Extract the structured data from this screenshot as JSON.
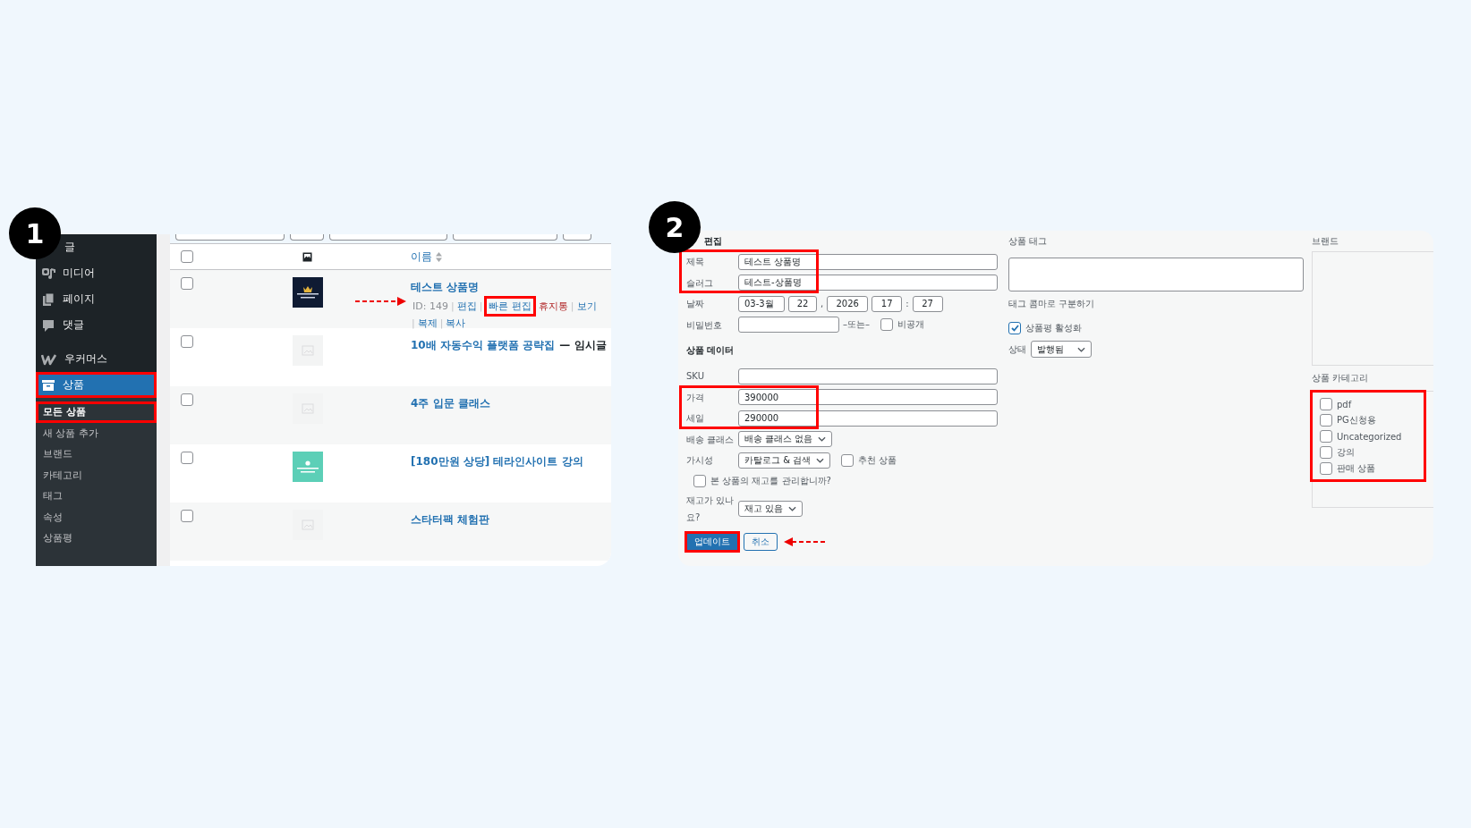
{
  "product_list": {
    "badge": "1",
    "sidebar": {
      "items": [
        {
          "label": "글",
          "selected": false,
          "highlighted": false
        },
        {
          "label": "미디어",
          "selected": false,
          "highlighted": false
        },
        {
          "label": "페이지",
          "selected": false,
          "highlighted": false
        },
        {
          "label": "댓글",
          "selected": false,
          "highlighted": false
        },
        {
          "label": "우커머스",
          "selected": false,
          "highlighted": false
        },
        {
          "label": "상품",
          "selected": true,
          "highlighted": true
        }
      ],
      "submenu": [
        {
          "label": "모든 상품",
          "selected": true,
          "highlighted": true
        },
        {
          "label": "새 상품 추가",
          "selected": false,
          "highlighted": false
        },
        {
          "label": "브랜드",
          "selected": false,
          "highlighted": false
        },
        {
          "label": "카테고리",
          "selected": false,
          "highlighted": false
        },
        {
          "label": "태그",
          "selected": false,
          "highlighted": false
        },
        {
          "label": "속성",
          "selected": false,
          "highlighted": false
        },
        {
          "label": "상품평",
          "selected": false,
          "highlighted": false
        }
      ]
    },
    "table": {
      "select_all_checked": false,
      "columns": [
        {
          "label": "이름",
          "sortable": true
        }
      ],
      "rows": [
        {
          "title": "테스트 상품명",
          "checked": false,
          "actions": [
            {
              "label": "ID: 149",
              "kind": "id",
              "separator": "|",
              "highlighted": false
            },
            {
              "label": "편집",
              "kind": "link",
              "separator": "|",
              "highlighted": false
            },
            {
              "label": "빠른 편집",
              "kind": "link",
              "highlighted": true
            },
            {
              "label": "휴지통",
              "kind": "delete",
              "separator": "|",
              "highlighted": false
            },
            {
              "label": "보기",
              "kind": "link",
              "separator": "|",
              "highlighted": false
            },
            {
              "label": "복제",
              "kind": "link",
              "separator": "|",
              "highlighted": false
            },
            {
              "label": "복사",
              "kind": "link",
              "highlighted": false
            }
          ]
        },
        {
          "title": "10배 자동수익 플랫폼 공략집",
          "status": "— 임시글",
          "checked": false
        },
        {
          "title": "4주 입문 클래스",
          "checked": false
        },
        {
          "title": "[180만원 상당] 테라인사이트 강의",
          "checked": false
        },
        {
          "title": "스타터팩 체험판",
          "checked": false
        }
      ]
    }
  },
  "quick_edit": {
    "badge": "2",
    "heading": "편집",
    "fields": [
      {
        "kind": "text",
        "label": "제목",
        "value": "테스트 상품명",
        "highlighted": true
      },
      {
        "kind": "text",
        "label": "슬러그",
        "value": "테스트-상품명",
        "highlighted": true
      },
      {
        "kind": "date",
        "label": "날짜",
        "month": "03-3월",
        "day": "22",
        "date_separator": ",",
        "year": "2026",
        "hour": "17",
        "time_separator": ":",
        "minute": "27",
        "highlighted": false
      },
      {
        "kind": "password",
        "label": "비밀번호",
        "or": "–또는–",
        "checkbox": {
          "label": "비공개",
          "checked": false
        },
        "highlighted": false
      },
      {
        "kind": "heading",
        "label": "상품 데이터",
        "highlighted": false
      },
      {
        "kind": "text",
        "label": "SKU",
        "highlighted": false
      },
      {
        "kind": "text",
        "label": "가격",
        "value": "390000",
        "highlighted": true
      },
      {
        "kind": "text",
        "label": "세일",
        "value": "290000",
        "highlighted": true
      },
      {
        "kind": "select",
        "label": "배송 클래스",
        "value": "배송 클래스 없음",
        "highlighted": false
      },
      {
        "kind": "select",
        "label": "가시성",
        "value": "카탈로그 & 검색",
        "checkbox": {
          "label": "추천 상품",
          "checked": false
        },
        "highlighted": false
      },
      {
        "kind": "checkbox",
        "label": "본 상품의 재고를 관리합니까?",
        "checked": false,
        "highlighted": false
      },
      {
        "kind": "select",
        "label": "재고가 있나요?",
        "value": "재고 있음",
        "highlighted": false
      }
    ],
    "buttons": [
      {
        "label": "업데이트",
        "kind": "primary",
        "highlighted": true
      },
      {
        "label": "취소",
        "kind": "secondary",
        "highlighted": false
      }
    ],
    "tags": {
      "label": "상품 태그",
      "hint": "태그 콤마로 구분하기"
    },
    "reviews": {
      "label": "상품평 활성화",
      "checked": true
    },
    "status": {
      "label": "상태",
      "value": "발행됨"
    },
    "brand": {
      "label": "브랜드"
    },
    "categories": {
      "label": "상품 카테고리",
      "highlighted": true,
      "items": [
        {
          "label": "pdf",
          "checked": false
        },
        {
          "label": "PG신청용",
          "checked": false
        },
        {
          "label": "Uncategorized",
          "checked": false
        },
        {
          "label": "강의",
          "checked": false
        },
        {
          "label": "판매 상품",
          "checked": false
        }
      ]
    }
  }
}
